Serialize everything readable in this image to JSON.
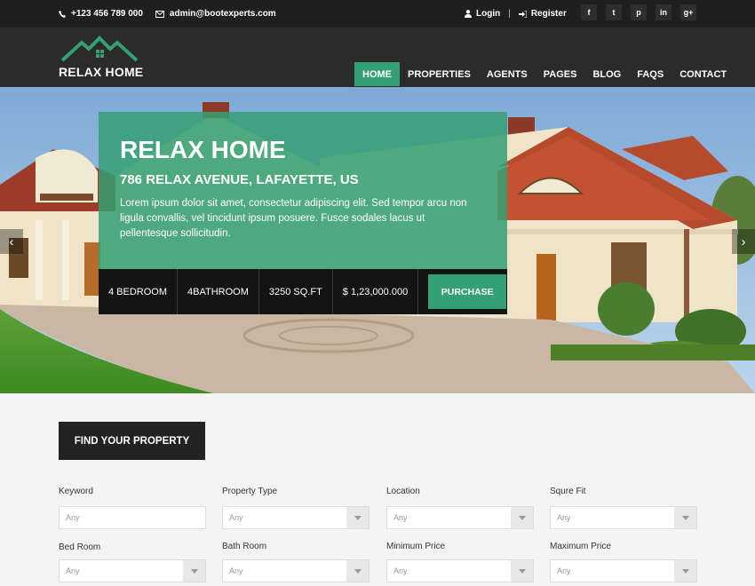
{
  "topbar": {
    "phone": "+123 456 789 000",
    "email": "admin@bootexperts.com",
    "login": "Login",
    "separator": "|",
    "register": "Register",
    "social": [
      "f",
      "t",
      "p",
      "in",
      "g+"
    ]
  },
  "header": {
    "logo_text": "RELAX HOME",
    "nav": [
      "HOME",
      "PROPERTIES",
      "AGENTS",
      "PAGES",
      "BLOG",
      "FAQS",
      "CONTACT"
    ],
    "active": "HOME"
  },
  "hero": {
    "title": "RELAX HOME",
    "address": "786 RELAX AVENUE, LAFAYETTE, US",
    "description": "Lorem ipsum dolor sit amet, consectetur adipiscing elit. Sed tempor arcu non ligula convallis, vel tincidunt ipsum posuere. Fusce sodales lacus ut pellentesque sollicitudin.",
    "stats": [
      "4 BEDROOM",
      "4BATHROOM",
      "3250 SQ.FT",
      "$ 1,23,000.000"
    ],
    "purchase_label": "PURCHASE",
    "prev_arrow": "‹",
    "next_arrow": "›"
  },
  "search": {
    "title": "FIND YOUR PROPERTY",
    "fields": [
      {
        "label": "Keyword",
        "value": "Any",
        "dropdown": false
      },
      {
        "label": "Property Type",
        "value": "Any",
        "dropdown": true
      },
      {
        "label": "Location",
        "value": "Any",
        "dropdown": true
      },
      {
        "label": "Squre Fit",
        "value": "Any",
        "dropdown": true
      },
      {
        "label": "Bed Room",
        "value": "Any",
        "dropdown": true
      },
      {
        "label": "Bath Room",
        "value": "Any",
        "dropdown": true
      },
      {
        "label": "Minimum Price",
        "value": "Any",
        "dropdown": true
      },
      {
        "label": "Maximum Price",
        "value": "Any",
        "dropdown": true
      }
    ]
  },
  "colors": {
    "accent": "#34a073",
    "dark": "#1f1f1f",
    "header": "#2b2b2b"
  }
}
